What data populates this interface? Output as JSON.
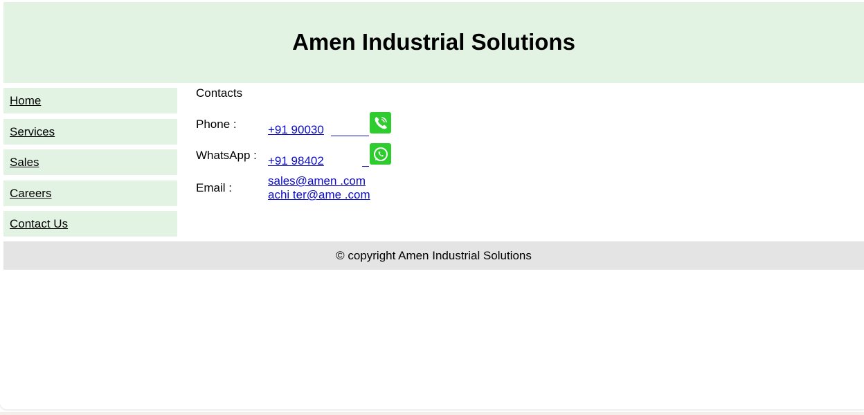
{
  "header": {
    "title": "Amen Industrial Solutions"
  },
  "nav": {
    "items": [
      {
        "label": "Home"
      },
      {
        "label": "Services"
      },
      {
        "label": "Sales"
      },
      {
        "label": "Careers"
      },
      {
        "label": "Contact Us"
      }
    ]
  },
  "contacts": {
    "title": "Contacts",
    "phone": {
      "label": "Phone :",
      "value": "+91 90030",
      "icon": "phone-call-icon"
    },
    "whatsapp": {
      "label": "WhatsApp :",
      "value": "+91 98402",
      "icon": "whatsapp-icon"
    },
    "email": {
      "label": "Email :",
      "values": [
        "sales@amen .com",
        "achi ter@ame .com"
      ]
    }
  },
  "footer": {
    "text": "© copyright Amen Industrial Solutions"
  },
  "colors": {
    "header_bg": "#e3f3e3",
    "nav_bg": "#e3f3e3",
    "footer_bg": "#e4e4e4",
    "link": "#0b0bc8",
    "icon_green": "#2fcc2f"
  }
}
